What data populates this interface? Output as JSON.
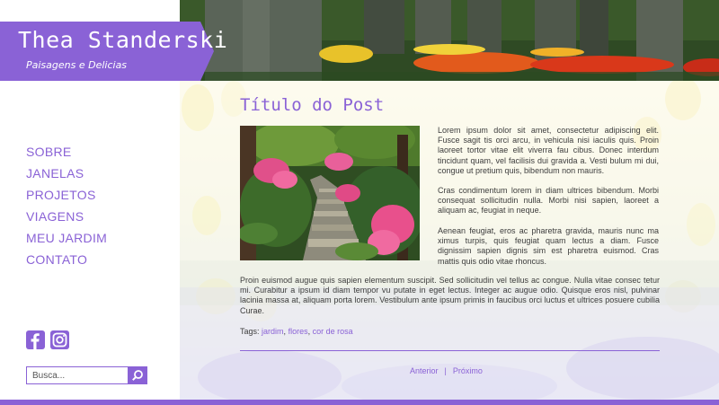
{
  "site": {
    "name": "Thea Standerski",
    "tagline": "Paisagens e Delicias"
  },
  "nav": {
    "items": [
      {
        "label": "SOBRE"
      },
      {
        "label": "JANELAS"
      },
      {
        "label": "PROJETOS"
      },
      {
        "label": "VIAGENS"
      },
      {
        "label": "MEU JARDIM"
      },
      {
        "label": "CONTATO"
      }
    ]
  },
  "social": {
    "icons": [
      "facebook-icon",
      "instagram-icon"
    ]
  },
  "search": {
    "placeholder": "Busca..."
  },
  "post": {
    "title": "Título do Post",
    "paragraphs": [
      "Lorem ipsum dolor sit amet, consectetur adipiscing elit. Fusce sagit tis orci arcu, in vehicula nisi iaculis quis. Proin laoreet tortor vitae elit viverra fau cibus. Donec interdum tincidunt quam, vel facilisis dui gravida a. Vesti bulum mi dui, congue ut pretium quis, bibendum non mauris.",
      "Cras condimentum lorem in diam ultrices bibendum. Morbi consequat sollicitudin nulla. Morbi nisi sapien, laoreet a aliquam ac, feugiat in neque.",
      "Aenean feugiat, eros ac pharetra gravida, mauris nunc ma ximus turpis, quis feugiat quam lectus a diam. Fusce dignissim sapien dignis sim est pharetra euismod. Cras mattis quis odio vitae rhoncus.",
      "Proin euismod augue quis sapien elementum suscipit. Sed sollicitudin vel tellus ac congue. Nulla vitae consec tetur mi. Curabitur a ipsum id diam tempor vu putate in eget lectus. Integer ac augue odio. Quisque eros nisl, pulvinar lacinia massa at, aliquam porta lorem. Vestibulum ante ipsum primis in faucibus orci luctus et ultrices posuere cubilia Curae."
    ],
    "tags_label": "Tags:",
    "tags": [
      "jardim",
      "flores",
      "cor de rosa"
    ]
  },
  "pager": {
    "previous": "Anterior",
    "separator": "|",
    "next": "Próximo"
  },
  "colors": {
    "accent": "#8a62d6",
    "text": "#3d3d3d"
  }
}
